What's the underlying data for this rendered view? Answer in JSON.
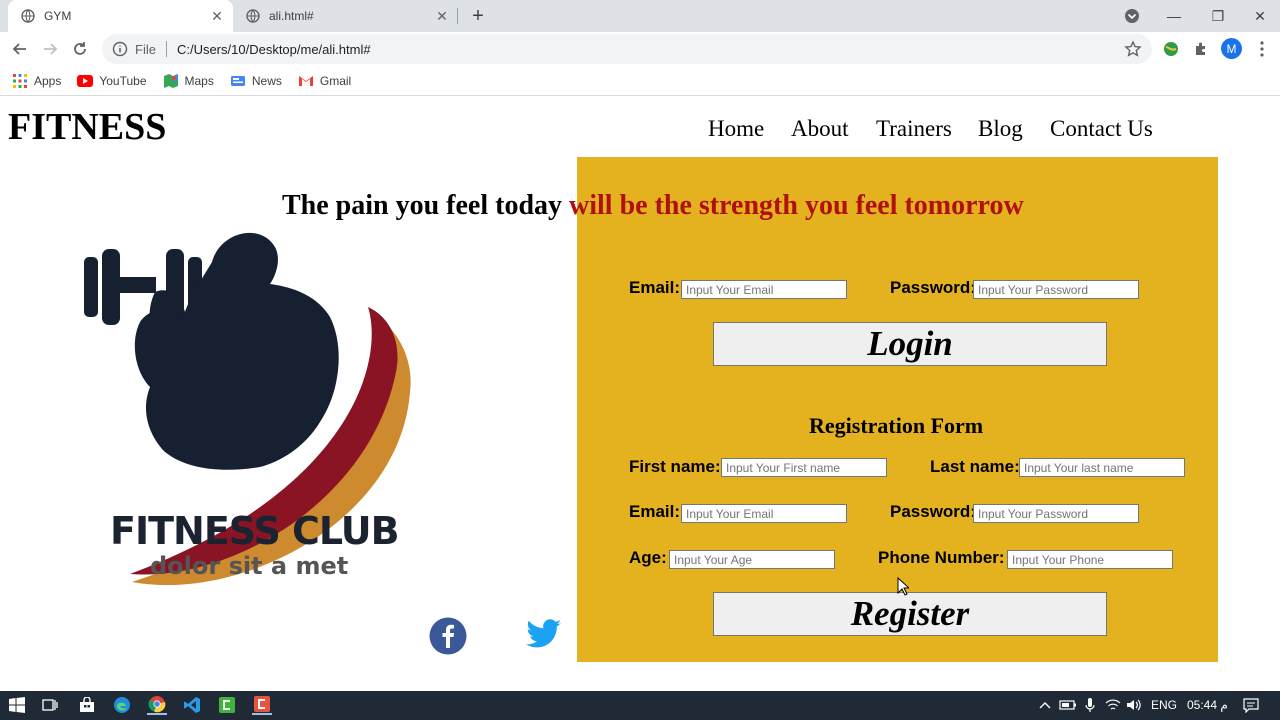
{
  "browser": {
    "tabs": [
      {
        "title": "GYM",
        "active": true
      },
      {
        "title": "ali.html#",
        "active": false
      }
    ],
    "url_scheme_label": "File",
    "url": "C:/Users/10/Desktop/me/ali.html#",
    "avatar_letter": "M",
    "bookmarks": [
      {
        "label": "Apps",
        "icon": "apps-grid-icon"
      },
      {
        "label": "YouTube",
        "icon": "youtube-icon"
      },
      {
        "label": "Maps",
        "icon": "maps-icon"
      },
      {
        "label": "News",
        "icon": "news-icon"
      },
      {
        "label": "Gmail",
        "icon": "gmail-icon"
      }
    ]
  },
  "site": {
    "logo": "FITNESS",
    "nav": [
      "Home",
      "About",
      "Trainers",
      "Blog",
      "Contact Us"
    ],
    "quote_part1": "The pain you feel today",
    "quote_part2": " will be the strength you feel tomorrow",
    "club_title": "FITNESS CLUB",
    "club_subtitle": "dolor sit a met",
    "social": [
      "facebook-icon",
      "twitter-icon"
    ]
  },
  "login": {
    "email_label": "Email:",
    "email_placeholder": "Input Your Email",
    "password_label": "Password:",
    "password_placeholder": "Input Your Password",
    "button": "Login"
  },
  "register": {
    "title": "Registration Form",
    "first_name_label": "First name:",
    "first_name_placeholder": "Input Your First name",
    "last_name_label": "Last name:",
    "last_name_placeholder": "Input Your last name",
    "email_label": "Email:",
    "email_placeholder": "Input Your Email",
    "password_label": "Password:",
    "password_placeholder": "Input Your Password",
    "age_label": "Age:",
    "age_placeholder": "Input Your Age",
    "phone_label": "Phone Number:",
    "phone_placeholder": "Input Your Phone",
    "button": "Register"
  },
  "taskbar": {
    "lang": "ENG",
    "time": "05:44 م"
  },
  "colors": {
    "panel": "#e3b21e",
    "quote_accent": "#b01010",
    "taskbar": "#1f2a36"
  }
}
